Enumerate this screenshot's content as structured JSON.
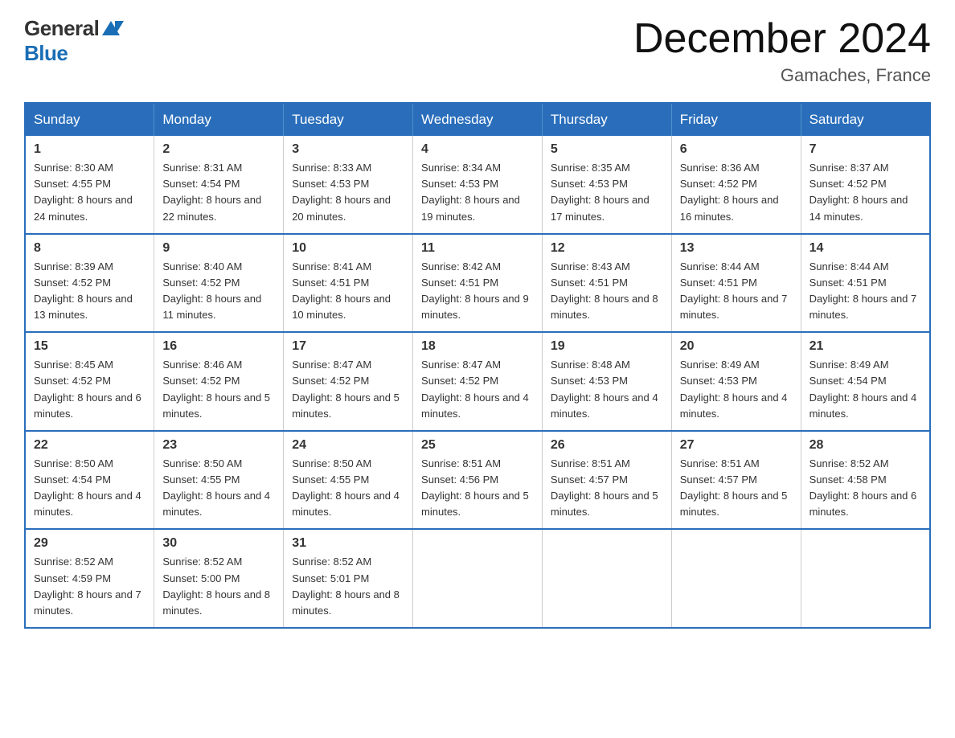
{
  "header": {
    "logo_general": "General",
    "logo_blue": "Blue",
    "month_title": "December 2024",
    "location": "Gamaches, France"
  },
  "days_of_week": [
    "Sunday",
    "Monday",
    "Tuesday",
    "Wednesday",
    "Thursday",
    "Friday",
    "Saturday"
  ],
  "weeks": [
    [
      {
        "day": "1",
        "sunrise": "Sunrise: 8:30 AM",
        "sunset": "Sunset: 4:55 PM",
        "daylight": "Daylight: 8 hours and 24 minutes."
      },
      {
        "day": "2",
        "sunrise": "Sunrise: 8:31 AM",
        "sunset": "Sunset: 4:54 PM",
        "daylight": "Daylight: 8 hours and 22 minutes."
      },
      {
        "day": "3",
        "sunrise": "Sunrise: 8:33 AM",
        "sunset": "Sunset: 4:53 PM",
        "daylight": "Daylight: 8 hours and 20 minutes."
      },
      {
        "day": "4",
        "sunrise": "Sunrise: 8:34 AM",
        "sunset": "Sunset: 4:53 PM",
        "daylight": "Daylight: 8 hours and 19 minutes."
      },
      {
        "day": "5",
        "sunrise": "Sunrise: 8:35 AM",
        "sunset": "Sunset: 4:53 PM",
        "daylight": "Daylight: 8 hours and 17 minutes."
      },
      {
        "day": "6",
        "sunrise": "Sunrise: 8:36 AM",
        "sunset": "Sunset: 4:52 PM",
        "daylight": "Daylight: 8 hours and 16 minutes."
      },
      {
        "day": "7",
        "sunrise": "Sunrise: 8:37 AM",
        "sunset": "Sunset: 4:52 PM",
        "daylight": "Daylight: 8 hours and 14 minutes."
      }
    ],
    [
      {
        "day": "8",
        "sunrise": "Sunrise: 8:39 AM",
        "sunset": "Sunset: 4:52 PM",
        "daylight": "Daylight: 8 hours and 13 minutes."
      },
      {
        "day": "9",
        "sunrise": "Sunrise: 8:40 AM",
        "sunset": "Sunset: 4:52 PM",
        "daylight": "Daylight: 8 hours and 11 minutes."
      },
      {
        "day": "10",
        "sunrise": "Sunrise: 8:41 AM",
        "sunset": "Sunset: 4:51 PM",
        "daylight": "Daylight: 8 hours and 10 minutes."
      },
      {
        "day": "11",
        "sunrise": "Sunrise: 8:42 AM",
        "sunset": "Sunset: 4:51 PM",
        "daylight": "Daylight: 8 hours and 9 minutes."
      },
      {
        "day": "12",
        "sunrise": "Sunrise: 8:43 AM",
        "sunset": "Sunset: 4:51 PM",
        "daylight": "Daylight: 8 hours and 8 minutes."
      },
      {
        "day": "13",
        "sunrise": "Sunrise: 8:44 AM",
        "sunset": "Sunset: 4:51 PM",
        "daylight": "Daylight: 8 hours and 7 minutes."
      },
      {
        "day": "14",
        "sunrise": "Sunrise: 8:44 AM",
        "sunset": "Sunset: 4:51 PM",
        "daylight": "Daylight: 8 hours and 7 minutes."
      }
    ],
    [
      {
        "day": "15",
        "sunrise": "Sunrise: 8:45 AM",
        "sunset": "Sunset: 4:52 PM",
        "daylight": "Daylight: 8 hours and 6 minutes."
      },
      {
        "day": "16",
        "sunrise": "Sunrise: 8:46 AM",
        "sunset": "Sunset: 4:52 PM",
        "daylight": "Daylight: 8 hours and 5 minutes."
      },
      {
        "day": "17",
        "sunrise": "Sunrise: 8:47 AM",
        "sunset": "Sunset: 4:52 PM",
        "daylight": "Daylight: 8 hours and 5 minutes."
      },
      {
        "day": "18",
        "sunrise": "Sunrise: 8:47 AM",
        "sunset": "Sunset: 4:52 PM",
        "daylight": "Daylight: 8 hours and 4 minutes."
      },
      {
        "day": "19",
        "sunrise": "Sunrise: 8:48 AM",
        "sunset": "Sunset: 4:53 PM",
        "daylight": "Daylight: 8 hours and 4 minutes."
      },
      {
        "day": "20",
        "sunrise": "Sunrise: 8:49 AM",
        "sunset": "Sunset: 4:53 PM",
        "daylight": "Daylight: 8 hours and 4 minutes."
      },
      {
        "day": "21",
        "sunrise": "Sunrise: 8:49 AM",
        "sunset": "Sunset: 4:54 PM",
        "daylight": "Daylight: 8 hours and 4 minutes."
      }
    ],
    [
      {
        "day": "22",
        "sunrise": "Sunrise: 8:50 AM",
        "sunset": "Sunset: 4:54 PM",
        "daylight": "Daylight: 8 hours and 4 minutes."
      },
      {
        "day": "23",
        "sunrise": "Sunrise: 8:50 AM",
        "sunset": "Sunset: 4:55 PM",
        "daylight": "Daylight: 8 hours and 4 minutes."
      },
      {
        "day": "24",
        "sunrise": "Sunrise: 8:50 AM",
        "sunset": "Sunset: 4:55 PM",
        "daylight": "Daylight: 8 hours and 4 minutes."
      },
      {
        "day": "25",
        "sunrise": "Sunrise: 8:51 AM",
        "sunset": "Sunset: 4:56 PM",
        "daylight": "Daylight: 8 hours and 5 minutes."
      },
      {
        "day": "26",
        "sunrise": "Sunrise: 8:51 AM",
        "sunset": "Sunset: 4:57 PM",
        "daylight": "Daylight: 8 hours and 5 minutes."
      },
      {
        "day": "27",
        "sunrise": "Sunrise: 8:51 AM",
        "sunset": "Sunset: 4:57 PM",
        "daylight": "Daylight: 8 hours and 5 minutes."
      },
      {
        "day": "28",
        "sunrise": "Sunrise: 8:52 AM",
        "sunset": "Sunset: 4:58 PM",
        "daylight": "Daylight: 8 hours and 6 minutes."
      }
    ],
    [
      {
        "day": "29",
        "sunrise": "Sunrise: 8:52 AM",
        "sunset": "Sunset: 4:59 PM",
        "daylight": "Daylight: 8 hours and 7 minutes."
      },
      {
        "day": "30",
        "sunrise": "Sunrise: 8:52 AM",
        "sunset": "Sunset: 5:00 PM",
        "daylight": "Daylight: 8 hours and 8 minutes."
      },
      {
        "day": "31",
        "sunrise": "Sunrise: 8:52 AM",
        "sunset": "Sunset: 5:01 PM",
        "daylight": "Daylight: 8 hours and 8 minutes."
      },
      null,
      null,
      null,
      null
    ]
  ]
}
